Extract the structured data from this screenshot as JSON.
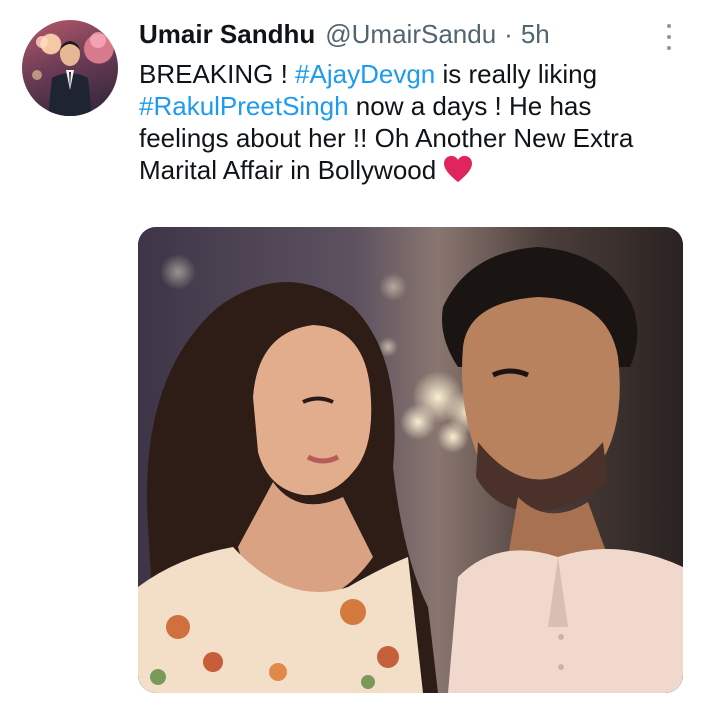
{
  "tweet": {
    "author_name": "Umair Sandhu",
    "handle": "@UmairSandu",
    "separator": "·",
    "time": "5h",
    "text_parts": {
      "p1": "BREAKING ! ",
      "h1": "#AjayDevgn",
      "p2": " is really liking",
      "h2": "#RakulPreetSingh",
      "p3": " now a days ! He has feelings about her !! Oh Another New Extra Marital Affair in Bollywood "
    },
    "emoji": "red-heart",
    "link_color": "#1d9bf0",
    "heart_color": "#e0245e"
  },
  "icons": {
    "more": "more-vertical-icon",
    "heart": "heart-icon"
  }
}
